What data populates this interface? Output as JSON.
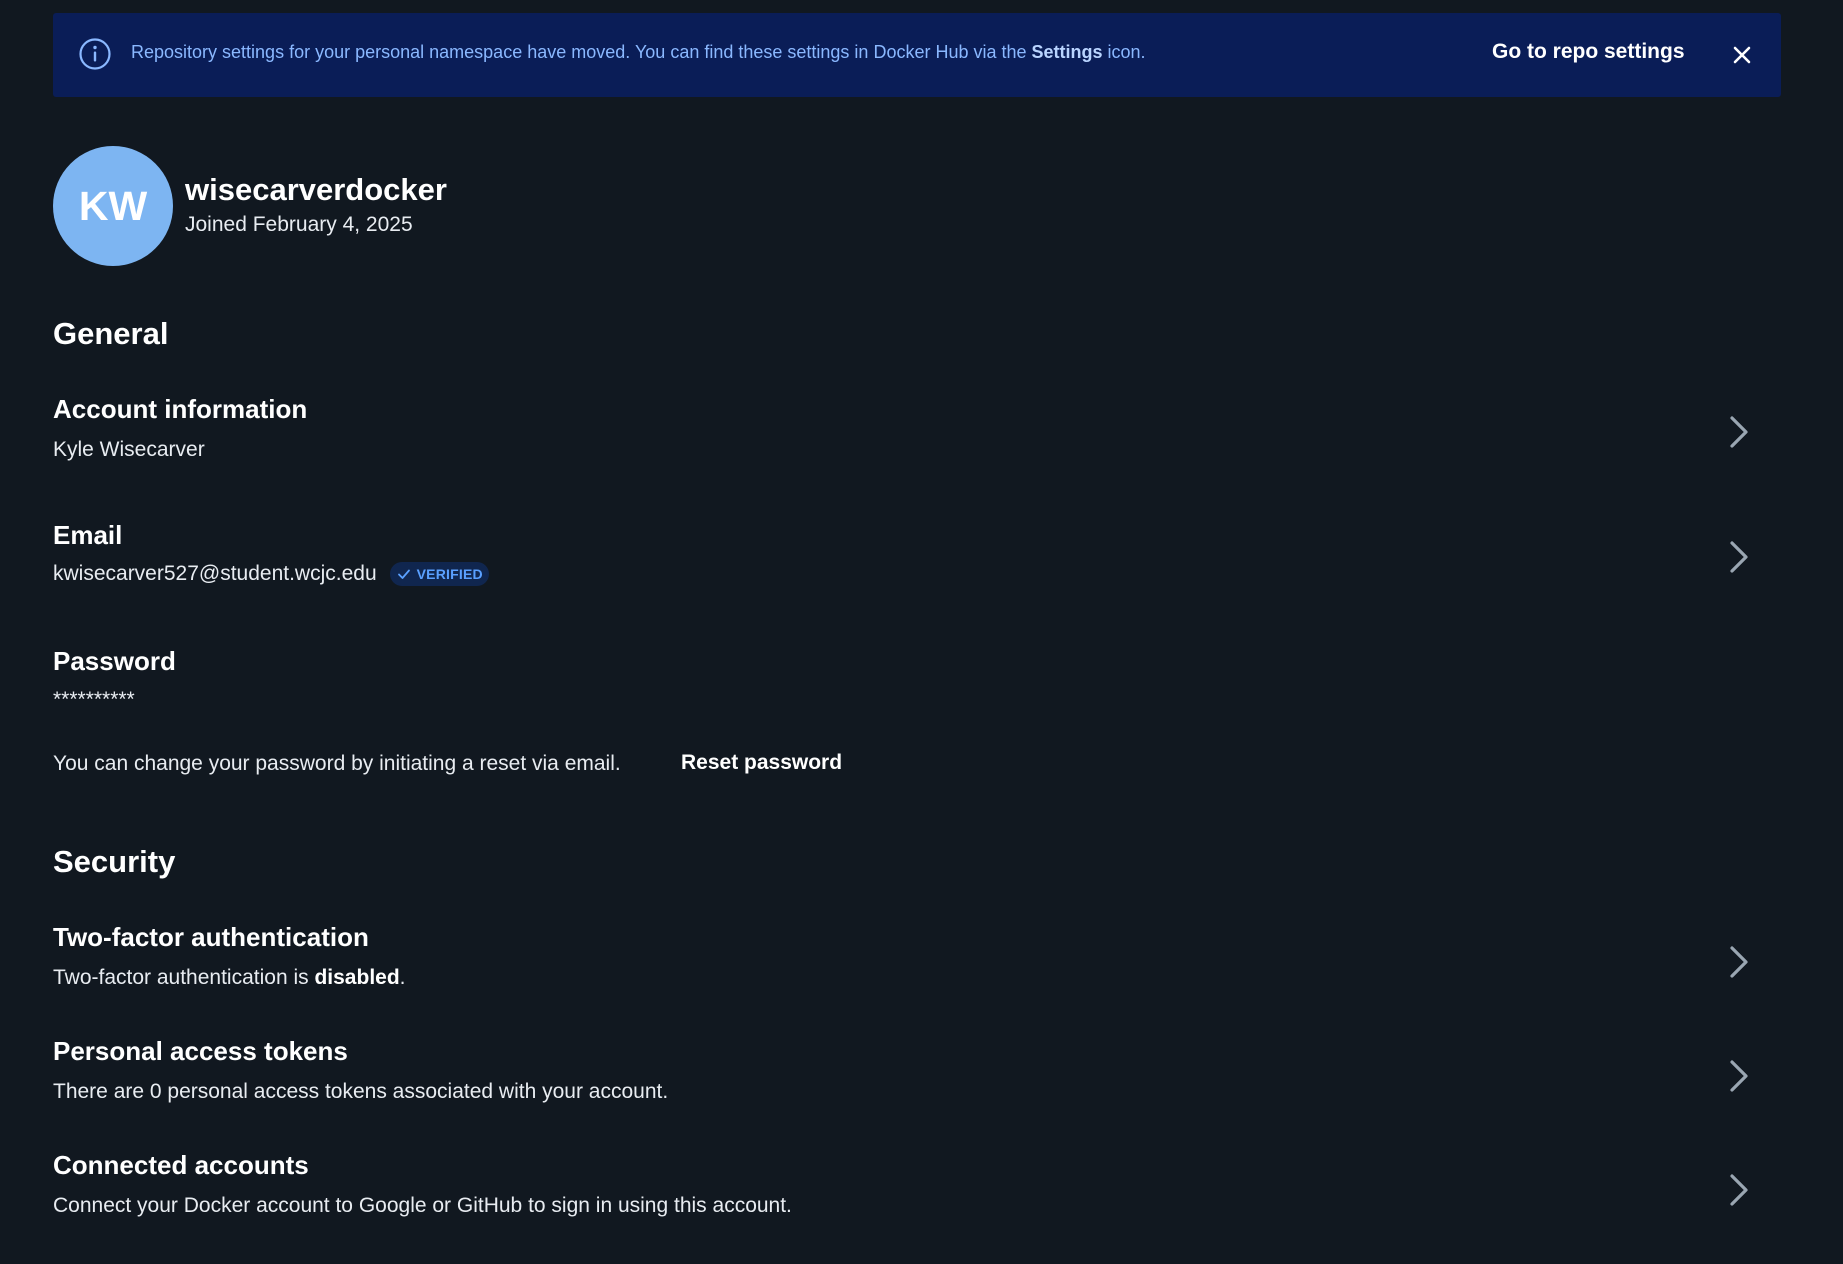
{
  "banner": {
    "icon": "info-icon",
    "message_prefix": "Repository settings for your personal namespace have moved. You can find these settings in Docker Hub via the ",
    "message_bold": "Settings",
    "message_suffix": " icon.",
    "link_label": "Go to repo settings",
    "close_icon": "close-icon",
    "background": "#0a1d57",
    "text_color": "#8ab8ff"
  },
  "profile": {
    "initials": "KW",
    "username": "wisecarverdocker",
    "joined": "Joined February 4, 2025",
    "avatar_color": "#7db5f2"
  },
  "general": {
    "title": "General",
    "account": {
      "title": "Account information",
      "value": "Kyle Wisecarver"
    },
    "email": {
      "title": "Email",
      "value": "kwisecarver527@student.wcjc.edu",
      "badge": "VERIFIED"
    },
    "password": {
      "title": "Password",
      "value": "**********",
      "note": "You can change your password by initiating a reset via email.",
      "reset_label": "Reset password"
    }
  },
  "security": {
    "title": "Security",
    "two_factor": {
      "title": "Two-factor authentication",
      "value_prefix": "Two-factor authentication is ",
      "value_bold": "disabled",
      "value_suffix": "."
    },
    "tokens": {
      "title": "Personal access tokens",
      "value": "There are 0 personal access tokens associated with your account."
    },
    "connected": {
      "title": "Connected accounts",
      "value": "Connect your Docker account to Google or GitHub to sign in using this account."
    }
  },
  "colors": {
    "page_background": "#111820",
    "badge_text": "#5aa0ff",
    "chevron": "#9aa6b2"
  }
}
